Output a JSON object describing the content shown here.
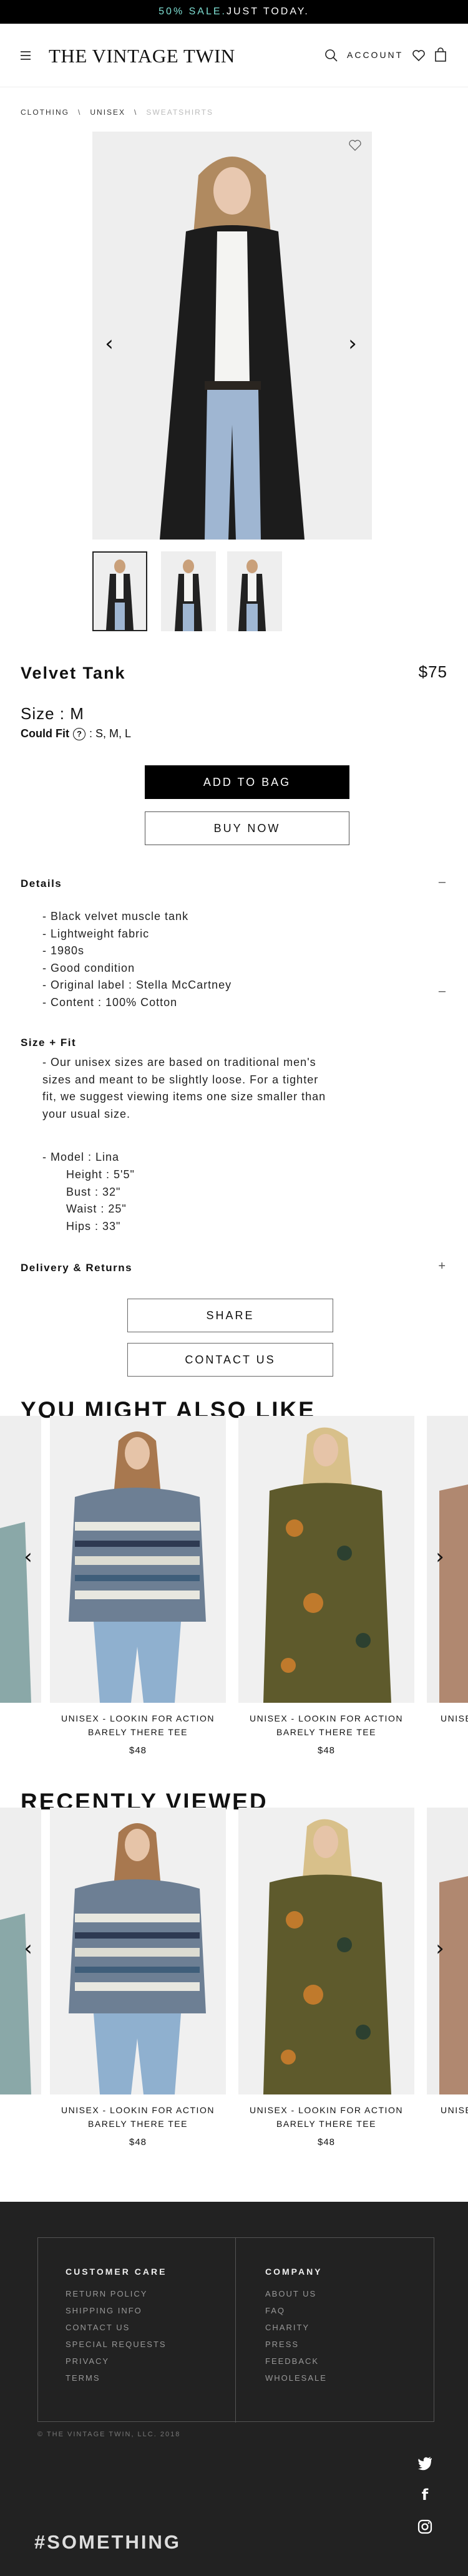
{
  "promo": {
    "sale": "50% SALE.",
    "rest": " JUST TODAY."
  },
  "header": {
    "logo": "THE VINTAGE TWIN",
    "account": "ACCOUNT"
  },
  "breadcrumb": {
    "items": [
      "CLOTHING",
      "UNISEX",
      "SWEATSHIRTS"
    ],
    "separator": "\\"
  },
  "product": {
    "title": "Velvet Tank",
    "price": "$75",
    "size_label": "Size : M",
    "fit_label": "Could Fit",
    "fit_sizes": ": S, M, L",
    "add_to_bag": "ADD TO BAG",
    "buy_now": "BUY NOW"
  },
  "details": {
    "heading": "Details",
    "toggle": "–",
    "items": [
      "- Black velvet muscle tank",
      "- Lightweight fabric",
      "- 1980s",
      "- Good condition",
      "- Original label : Stella McCartney",
      "- Content : 100% Cotton"
    ],
    "side_toggle": "–"
  },
  "size_fit": {
    "heading": "Size + Fit",
    "text": "- Our unisex sizes are based on traditional men's sizes and meant to be slightly loose. For a tighter fit, we suggest viewing items one size smaller than your usual size.",
    "model": "- Model : Lina",
    "measurements": [
      "Height : 5'5\"",
      "Bust : 32\"",
      "Waist : 25\"",
      "Hips : 33\""
    ]
  },
  "delivery": {
    "heading": "Delivery & Returns",
    "toggle": "+"
  },
  "actions": {
    "share": "SHARE",
    "contact": "CONTACT US"
  },
  "also_like": {
    "title": "YOU MIGHT ALSO LIKE",
    "cards": [
      {
        "name_line1": "UNISEX - LOOKIN FOR ACTION",
        "name_line2": "BARELY THERE TEE",
        "price": "$48"
      },
      {
        "name_line1": "UNISEX - LOOKIN FOR ACTION",
        "name_line2": "BARELY THERE TEE",
        "price": "$48"
      },
      {
        "name_line1": "UNISE",
        "name_line2": "",
        "price": ""
      }
    ]
  },
  "recently_viewed": {
    "title": "RECENTLY VIEWED",
    "cards": [
      {
        "name_line1": "UNISEX - LOOKIN FOR ACTION",
        "name_line2": "BARELY THERE TEE",
        "price": "$48"
      },
      {
        "name_line1": "UNISEX - LOOKIN FOR ACTION",
        "name_line2": "BARELY THERE TEE",
        "price": "$48"
      },
      {
        "name_line1": "UNISE",
        "name_line2": "",
        "price": ""
      }
    ]
  },
  "footer": {
    "customer_care": {
      "heading": "CUSTOMER CARE",
      "links": [
        "RETURN POLICY",
        "SHIPPING INFO",
        "CONTACT US",
        "SPECIAL REQUESTS",
        "PRIVACY",
        "TERMS"
      ]
    },
    "company": {
      "heading": "COMPANY",
      "links": [
        "ABOUT US",
        "FAQ",
        "CHARITY",
        "PRESS",
        "FEEDBACK",
        "WHOLESALE"
      ]
    },
    "copyright": "© THE VINTAGE TWIN, LLC. 2018",
    "hashtag": "#SOMETHING"
  },
  "colors": {
    "promo_accent": "#7fe0d4",
    "footer_bg": "#222222"
  },
  "icons": [
    "menu-icon",
    "search-icon",
    "heart-icon",
    "bag-icon",
    "help-icon",
    "twitter-icon",
    "facebook-icon",
    "instagram-icon"
  ]
}
